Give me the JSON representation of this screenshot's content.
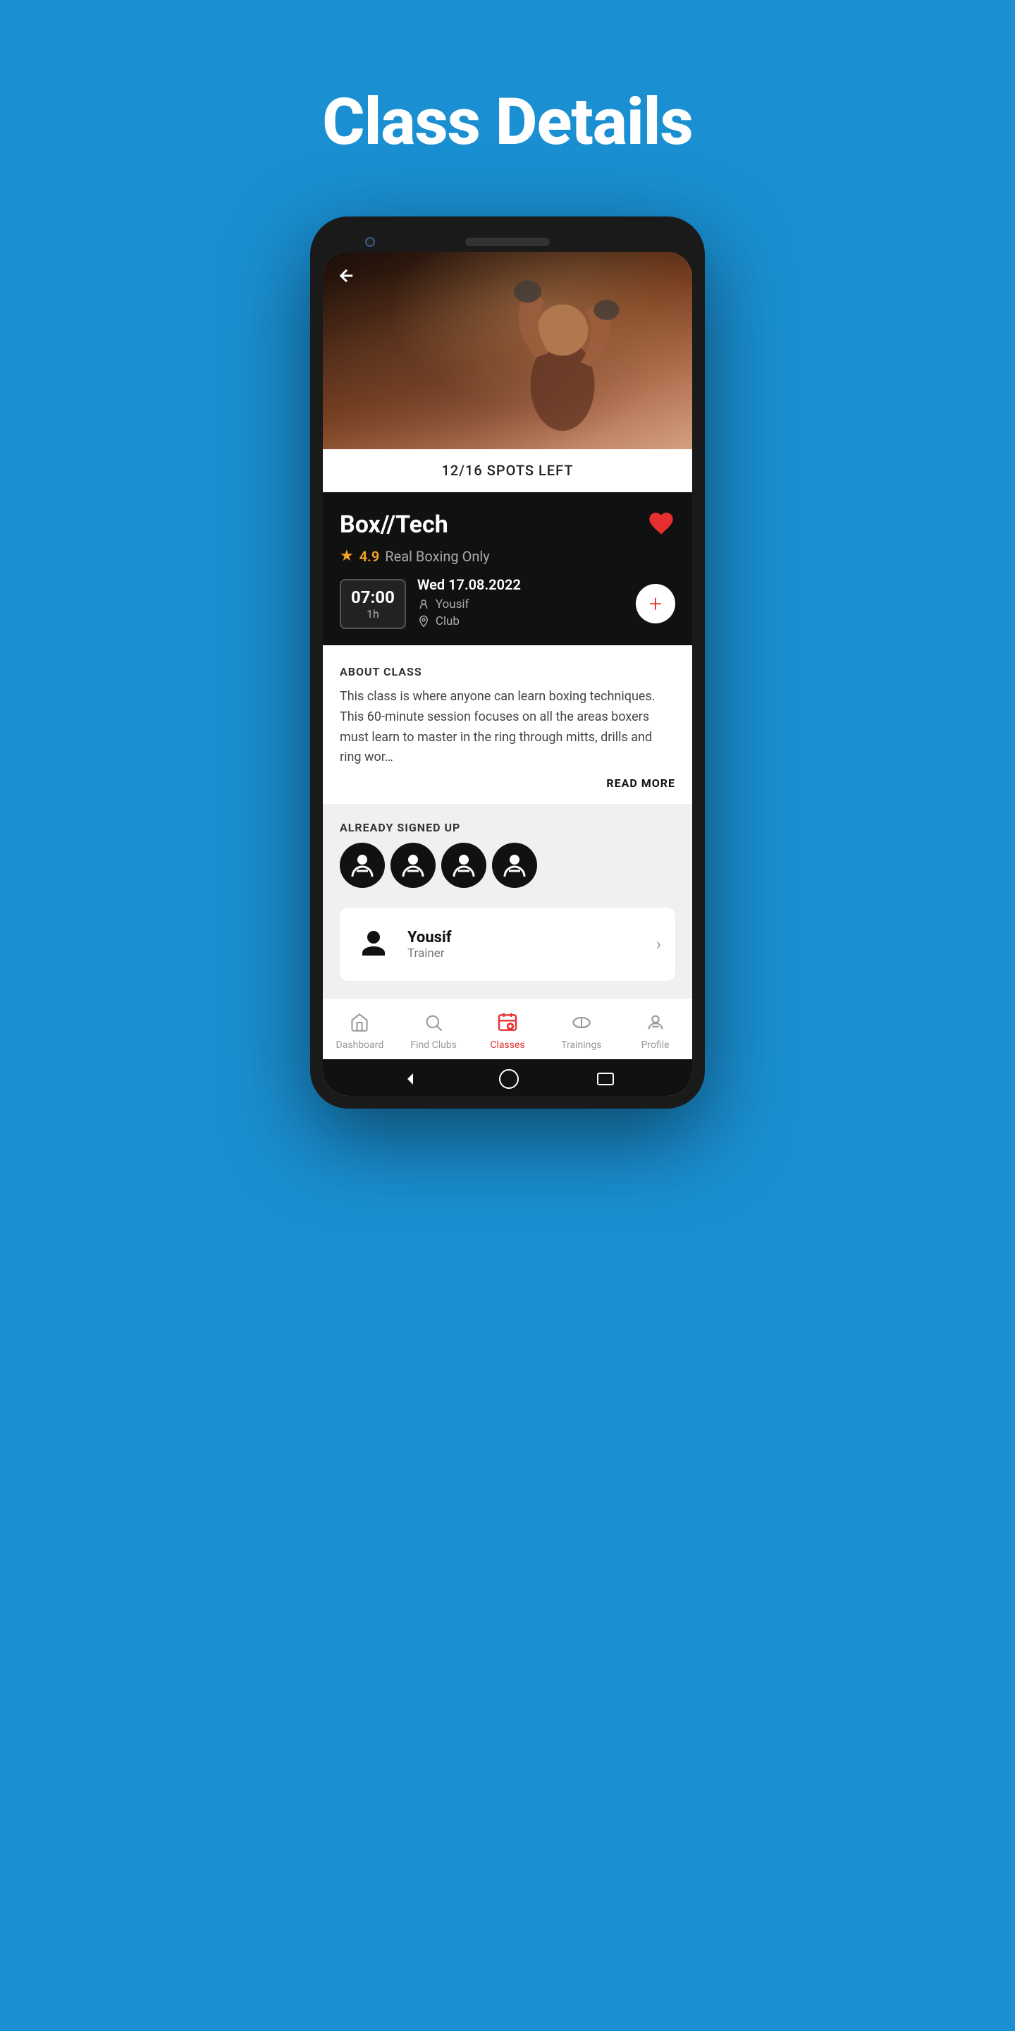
{
  "page": {
    "title": "Class Details",
    "background_color": "#1a8fd1"
  },
  "hero": {
    "spots_text": "12/16 SPOTS LEFT",
    "back_button_label": "←"
  },
  "class_info": {
    "title": "Box//Tech",
    "rating": "4.9",
    "club_name": "Real Boxing Only",
    "date": "Wed 17.08.2022",
    "trainer": "Yousif",
    "location": "Club",
    "time": "07:00",
    "duration": "1h"
  },
  "about": {
    "section_label": "ABOUT CLASS",
    "description": "This class is where anyone can learn boxing techniques. This 60-minute session focuses on all the areas boxers must learn to master in the ring through mitts, drills and ring wor…",
    "read_more_label": "READ MORE"
  },
  "signed_up": {
    "section_label": "ALREADY SIGNED UP",
    "count": 4
  },
  "trainer_card": {
    "name": "Yousif",
    "role": "Trainer"
  },
  "bottom_nav": {
    "items": [
      {
        "label": "Dashboard",
        "icon": "home-icon",
        "active": false
      },
      {
        "label": "Find Clubs",
        "icon": "search-clubs-icon",
        "active": false
      },
      {
        "label": "Classes",
        "icon": "classes-icon",
        "active": true
      },
      {
        "label": "Trainings",
        "icon": "trainings-icon",
        "active": false
      },
      {
        "label": "Profile",
        "icon": "profile-icon",
        "active": false
      }
    ]
  }
}
